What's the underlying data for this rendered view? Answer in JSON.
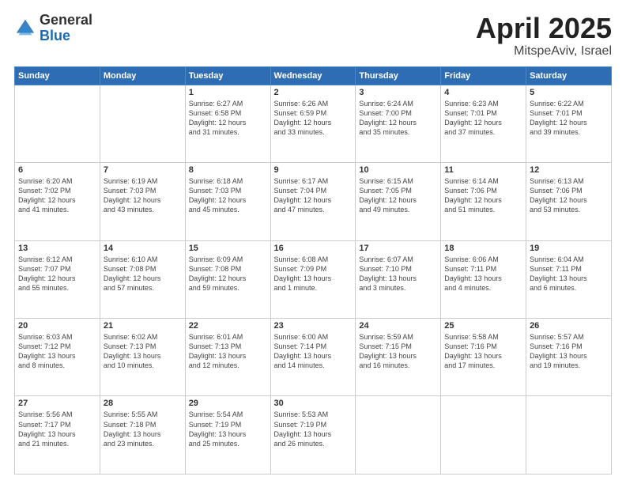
{
  "logo": {
    "general": "General",
    "blue": "Blue"
  },
  "title": {
    "month": "April 2025",
    "location": "MitspeAviv, Israel"
  },
  "header_days": [
    "Sunday",
    "Monday",
    "Tuesday",
    "Wednesday",
    "Thursday",
    "Friday",
    "Saturday"
  ],
  "weeks": [
    [
      {
        "day": "",
        "info": ""
      },
      {
        "day": "",
        "info": ""
      },
      {
        "day": "1",
        "info": "Sunrise: 6:27 AM\nSunset: 6:58 PM\nDaylight: 12 hours\nand 31 minutes."
      },
      {
        "day": "2",
        "info": "Sunrise: 6:26 AM\nSunset: 6:59 PM\nDaylight: 12 hours\nand 33 minutes."
      },
      {
        "day": "3",
        "info": "Sunrise: 6:24 AM\nSunset: 7:00 PM\nDaylight: 12 hours\nand 35 minutes."
      },
      {
        "day": "4",
        "info": "Sunrise: 6:23 AM\nSunset: 7:01 PM\nDaylight: 12 hours\nand 37 minutes."
      },
      {
        "day": "5",
        "info": "Sunrise: 6:22 AM\nSunset: 7:01 PM\nDaylight: 12 hours\nand 39 minutes."
      }
    ],
    [
      {
        "day": "6",
        "info": "Sunrise: 6:20 AM\nSunset: 7:02 PM\nDaylight: 12 hours\nand 41 minutes."
      },
      {
        "day": "7",
        "info": "Sunrise: 6:19 AM\nSunset: 7:03 PM\nDaylight: 12 hours\nand 43 minutes."
      },
      {
        "day": "8",
        "info": "Sunrise: 6:18 AM\nSunset: 7:03 PM\nDaylight: 12 hours\nand 45 minutes."
      },
      {
        "day": "9",
        "info": "Sunrise: 6:17 AM\nSunset: 7:04 PM\nDaylight: 12 hours\nand 47 minutes."
      },
      {
        "day": "10",
        "info": "Sunrise: 6:15 AM\nSunset: 7:05 PM\nDaylight: 12 hours\nand 49 minutes."
      },
      {
        "day": "11",
        "info": "Sunrise: 6:14 AM\nSunset: 7:06 PM\nDaylight: 12 hours\nand 51 minutes."
      },
      {
        "day": "12",
        "info": "Sunrise: 6:13 AM\nSunset: 7:06 PM\nDaylight: 12 hours\nand 53 minutes."
      }
    ],
    [
      {
        "day": "13",
        "info": "Sunrise: 6:12 AM\nSunset: 7:07 PM\nDaylight: 12 hours\nand 55 minutes."
      },
      {
        "day": "14",
        "info": "Sunrise: 6:10 AM\nSunset: 7:08 PM\nDaylight: 12 hours\nand 57 minutes."
      },
      {
        "day": "15",
        "info": "Sunrise: 6:09 AM\nSunset: 7:08 PM\nDaylight: 12 hours\nand 59 minutes."
      },
      {
        "day": "16",
        "info": "Sunrise: 6:08 AM\nSunset: 7:09 PM\nDaylight: 13 hours\nand 1 minute."
      },
      {
        "day": "17",
        "info": "Sunrise: 6:07 AM\nSunset: 7:10 PM\nDaylight: 13 hours\nand 3 minutes."
      },
      {
        "day": "18",
        "info": "Sunrise: 6:06 AM\nSunset: 7:11 PM\nDaylight: 13 hours\nand 4 minutes."
      },
      {
        "day": "19",
        "info": "Sunrise: 6:04 AM\nSunset: 7:11 PM\nDaylight: 13 hours\nand 6 minutes."
      }
    ],
    [
      {
        "day": "20",
        "info": "Sunrise: 6:03 AM\nSunset: 7:12 PM\nDaylight: 13 hours\nand 8 minutes."
      },
      {
        "day": "21",
        "info": "Sunrise: 6:02 AM\nSunset: 7:13 PM\nDaylight: 13 hours\nand 10 minutes."
      },
      {
        "day": "22",
        "info": "Sunrise: 6:01 AM\nSunset: 7:13 PM\nDaylight: 13 hours\nand 12 minutes."
      },
      {
        "day": "23",
        "info": "Sunrise: 6:00 AM\nSunset: 7:14 PM\nDaylight: 13 hours\nand 14 minutes."
      },
      {
        "day": "24",
        "info": "Sunrise: 5:59 AM\nSunset: 7:15 PM\nDaylight: 13 hours\nand 16 minutes."
      },
      {
        "day": "25",
        "info": "Sunrise: 5:58 AM\nSunset: 7:16 PM\nDaylight: 13 hours\nand 17 minutes."
      },
      {
        "day": "26",
        "info": "Sunrise: 5:57 AM\nSunset: 7:16 PM\nDaylight: 13 hours\nand 19 minutes."
      }
    ],
    [
      {
        "day": "27",
        "info": "Sunrise: 5:56 AM\nSunset: 7:17 PM\nDaylight: 13 hours\nand 21 minutes."
      },
      {
        "day": "28",
        "info": "Sunrise: 5:55 AM\nSunset: 7:18 PM\nDaylight: 13 hours\nand 23 minutes."
      },
      {
        "day": "29",
        "info": "Sunrise: 5:54 AM\nSunset: 7:19 PM\nDaylight: 13 hours\nand 25 minutes."
      },
      {
        "day": "30",
        "info": "Sunrise: 5:53 AM\nSunset: 7:19 PM\nDaylight: 13 hours\nand 26 minutes."
      },
      {
        "day": "",
        "info": ""
      },
      {
        "day": "",
        "info": ""
      },
      {
        "day": "",
        "info": ""
      }
    ]
  ]
}
